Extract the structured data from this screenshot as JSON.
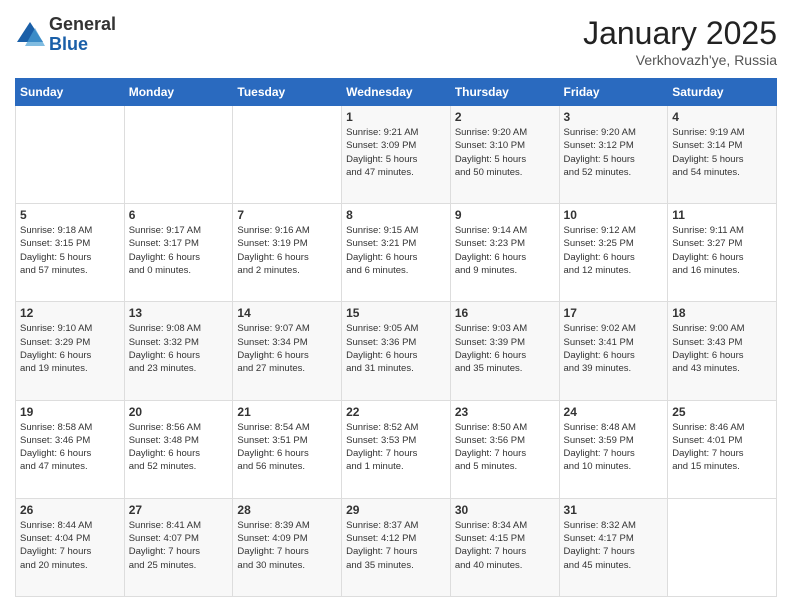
{
  "logo": {
    "general": "General",
    "blue": "Blue"
  },
  "header": {
    "month": "January 2025",
    "location": "Verkhovazh'ye, Russia"
  },
  "weekdays": [
    "Sunday",
    "Monday",
    "Tuesday",
    "Wednesday",
    "Thursday",
    "Friday",
    "Saturday"
  ],
  "weeks": [
    [
      {
        "day": "",
        "info": ""
      },
      {
        "day": "",
        "info": ""
      },
      {
        "day": "",
        "info": ""
      },
      {
        "day": "1",
        "info": "Sunrise: 9:21 AM\nSunset: 3:09 PM\nDaylight: 5 hours\nand 47 minutes."
      },
      {
        "day": "2",
        "info": "Sunrise: 9:20 AM\nSunset: 3:10 PM\nDaylight: 5 hours\nand 50 minutes."
      },
      {
        "day": "3",
        "info": "Sunrise: 9:20 AM\nSunset: 3:12 PM\nDaylight: 5 hours\nand 52 minutes."
      },
      {
        "day": "4",
        "info": "Sunrise: 9:19 AM\nSunset: 3:14 PM\nDaylight: 5 hours\nand 54 minutes."
      }
    ],
    [
      {
        "day": "5",
        "info": "Sunrise: 9:18 AM\nSunset: 3:15 PM\nDaylight: 5 hours\nand 57 minutes."
      },
      {
        "day": "6",
        "info": "Sunrise: 9:17 AM\nSunset: 3:17 PM\nDaylight: 6 hours\nand 0 minutes."
      },
      {
        "day": "7",
        "info": "Sunrise: 9:16 AM\nSunset: 3:19 PM\nDaylight: 6 hours\nand 2 minutes."
      },
      {
        "day": "8",
        "info": "Sunrise: 9:15 AM\nSunset: 3:21 PM\nDaylight: 6 hours\nand 6 minutes."
      },
      {
        "day": "9",
        "info": "Sunrise: 9:14 AM\nSunset: 3:23 PM\nDaylight: 6 hours\nand 9 minutes."
      },
      {
        "day": "10",
        "info": "Sunrise: 9:12 AM\nSunset: 3:25 PM\nDaylight: 6 hours\nand 12 minutes."
      },
      {
        "day": "11",
        "info": "Sunrise: 9:11 AM\nSunset: 3:27 PM\nDaylight: 6 hours\nand 16 minutes."
      }
    ],
    [
      {
        "day": "12",
        "info": "Sunrise: 9:10 AM\nSunset: 3:29 PM\nDaylight: 6 hours\nand 19 minutes."
      },
      {
        "day": "13",
        "info": "Sunrise: 9:08 AM\nSunset: 3:32 PM\nDaylight: 6 hours\nand 23 minutes."
      },
      {
        "day": "14",
        "info": "Sunrise: 9:07 AM\nSunset: 3:34 PM\nDaylight: 6 hours\nand 27 minutes."
      },
      {
        "day": "15",
        "info": "Sunrise: 9:05 AM\nSunset: 3:36 PM\nDaylight: 6 hours\nand 31 minutes."
      },
      {
        "day": "16",
        "info": "Sunrise: 9:03 AM\nSunset: 3:39 PM\nDaylight: 6 hours\nand 35 minutes."
      },
      {
        "day": "17",
        "info": "Sunrise: 9:02 AM\nSunset: 3:41 PM\nDaylight: 6 hours\nand 39 minutes."
      },
      {
        "day": "18",
        "info": "Sunrise: 9:00 AM\nSunset: 3:43 PM\nDaylight: 6 hours\nand 43 minutes."
      }
    ],
    [
      {
        "day": "19",
        "info": "Sunrise: 8:58 AM\nSunset: 3:46 PM\nDaylight: 6 hours\nand 47 minutes."
      },
      {
        "day": "20",
        "info": "Sunrise: 8:56 AM\nSunset: 3:48 PM\nDaylight: 6 hours\nand 52 minutes."
      },
      {
        "day": "21",
        "info": "Sunrise: 8:54 AM\nSunset: 3:51 PM\nDaylight: 6 hours\nand 56 minutes."
      },
      {
        "day": "22",
        "info": "Sunrise: 8:52 AM\nSunset: 3:53 PM\nDaylight: 7 hours\nand 1 minute."
      },
      {
        "day": "23",
        "info": "Sunrise: 8:50 AM\nSunset: 3:56 PM\nDaylight: 7 hours\nand 5 minutes."
      },
      {
        "day": "24",
        "info": "Sunrise: 8:48 AM\nSunset: 3:59 PM\nDaylight: 7 hours\nand 10 minutes."
      },
      {
        "day": "25",
        "info": "Sunrise: 8:46 AM\nSunset: 4:01 PM\nDaylight: 7 hours\nand 15 minutes."
      }
    ],
    [
      {
        "day": "26",
        "info": "Sunrise: 8:44 AM\nSunset: 4:04 PM\nDaylight: 7 hours\nand 20 minutes."
      },
      {
        "day": "27",
        "info": "Sunrise: 8:41 AM\nSunset: 4:07 PM\nDaylight: 7 hours\nand 25 minutes."
      },
      {
        "day": "28",
        "info": "Sunrise: 8:39 AM\nSunset: 4:09 PM\nDaylight: 7 hours\nand 30 minutes."
      },
      {
        "day": "29",
        "info": "Sunrise: 8:37 AM\nSunset: 4:12 PM\nDaylight: 7 hours\nand 35 minutes."
      },
      {
        "day": "30",
        "info": "Sunrise: 8:34 AM\nSunset: 4:15 PM\nDaylight: 7 hours\nand 40 minutes."
      },
      {
        "day": "31",
        "info": "Sunrise: 8:32 AM\nSunset: 4:17 PM\nDaylight: 7 hours\nand 45 minutes."
      },
      {
        "day": "",
        "info": ""
      }
    ]
  ]
}
